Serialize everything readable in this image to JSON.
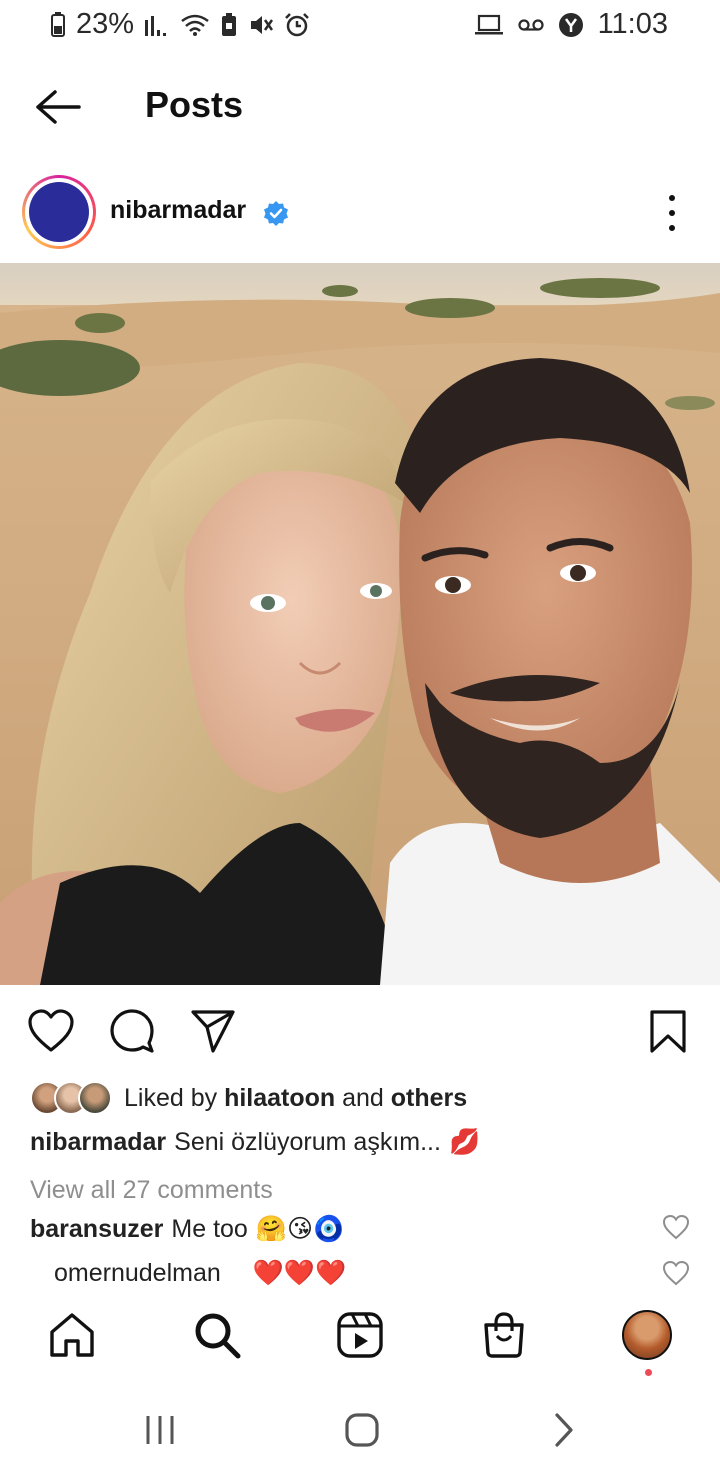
{
  "status_bar": {
    "battery": "23%",
    "time": "11:03",
    "icons": [
      "battery-icon",
      "signal-icon",
      "wifi-icon",
      "battery-saver-icon",
      "mute-icon",
      "alarm-icon",
      "laptop-icon",
      "voicemail-icon",
      "y-app-icon"
    ]
  },
  "header": {
    "title": "Posts",
    "back_icon": "arrow-left-icon"
  },
  "post": {
    "username": "nibarmadar",
    "verified": true,
    "avatar_color": "#2a2c9a",
    "photo_description_icon": "photo",
    "likes": {
      "prefix": "Liked by ",
      "user": "hilaatoon",
      "middle": " and ",
      "others": "others"
    },
    "caption": {
      "username": "nibarmadar",
      "text": "Seni özlüyorum aşkım...",
      "emoji": "💋"
    },
    "view_comments": "View all 27 comments",
    "comments": [
      {
        "username": "baransuzer",
        "text": "Me too",
        "emoji": "🤗😘🧿"
      },
      {
        "username": "omernudelman",
        "text": "",
        "emoji": "❤️❤️❤️"
      }
    ]
  },
  "actions": {
    "like": "heart-icon",
    "comment": "comment-icon",
    "share": "send-icon",
    "save": "bookmark-icon"
  },
  "bottom_nav": [
    "home-icon",
    "search-icon",
    "reels-icon",
    "shop-icon",
    "profile-avatar"
  ],
  "system_nav": [
    "recents-icon",
    "home-circle-icon",
    "back-chevron-icon"
  ],
  "colors": {
    "verified_blue": "#3897f0",
    "notification_red": "#ed4956",
    "muted_text": "#8e8e8e"
  }
}
